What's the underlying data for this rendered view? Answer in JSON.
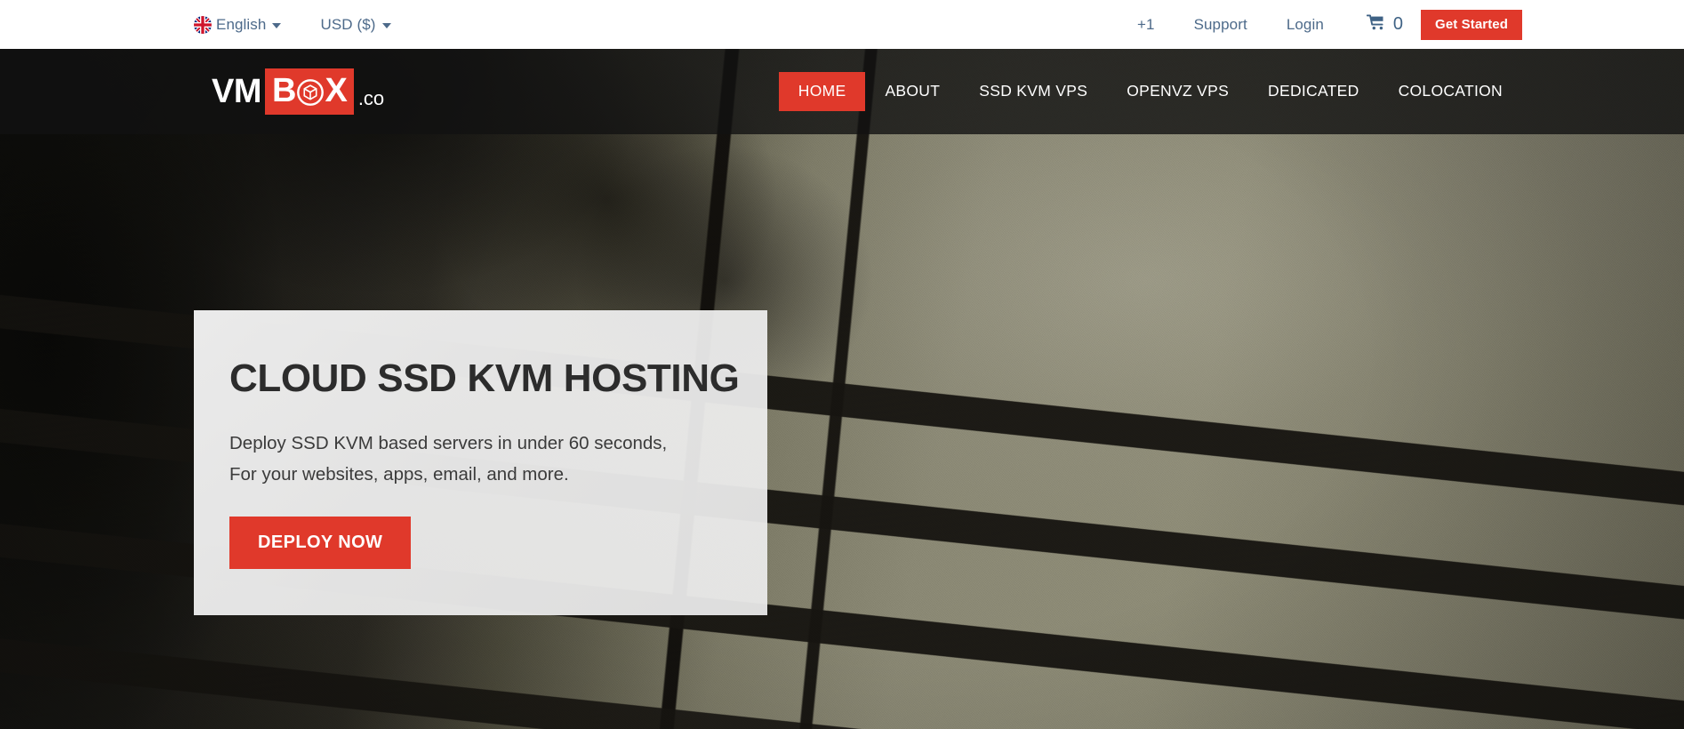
{
  "topbar": {
    "language": {
      "label": "English",
      "icon": "uk-flag-icon",
      "caret": "chevron-down-icon"
    },
    "currency": {
      "label": "USD ($)",
      "caret": "chevron-down-icon"
    },
    "phone": "+1",
    "support": "Support",
    "login": "Login",
    "cart": {
      "icon": "shopping-cart-icon",
      "count": "0"
    },
    "get_started": "Get Started"
  },
  "brand": {
    "vm": "VM",
    "box_left": "B",
    "box_icon": "cube-icon",
    "box_right": "X",
    "tld": ".co"
  },
  "nav": {
    "items": [
      {
        "label": "HOME",
        "active": true
      },
      {
        "label": "ABOUT",
        "active": false
      },
      {
        "label": "SSD KVM VPS",
        "active": false
      },
      {
        "label": "OPENVZ VPS",
        "active": false
      },
      {
        "label": "DEDICATED",
        "active": false
      },
      {
        "label": "COLOCATION",
        "active": false
      }
    ]
  },
  "hero": {
    "title": "CLOUD SSD KVM HOSTING",
    "subtitle_line1": "Deploy SSD KVM based servers in under 60 seconds,",
    "subtitle_line2": "For your websites, apps, email, and more.",
    "cta": "DEPLOY NOW"
  },
  "colors": {
    "accent_red": "#e0392b",
    "topbar_link": "#4d6a8a",
    "nav_text": "#ffffff",
    "card_bg": "#f0f0f0",
    "heading": "#2c2c2c"
  }
}
